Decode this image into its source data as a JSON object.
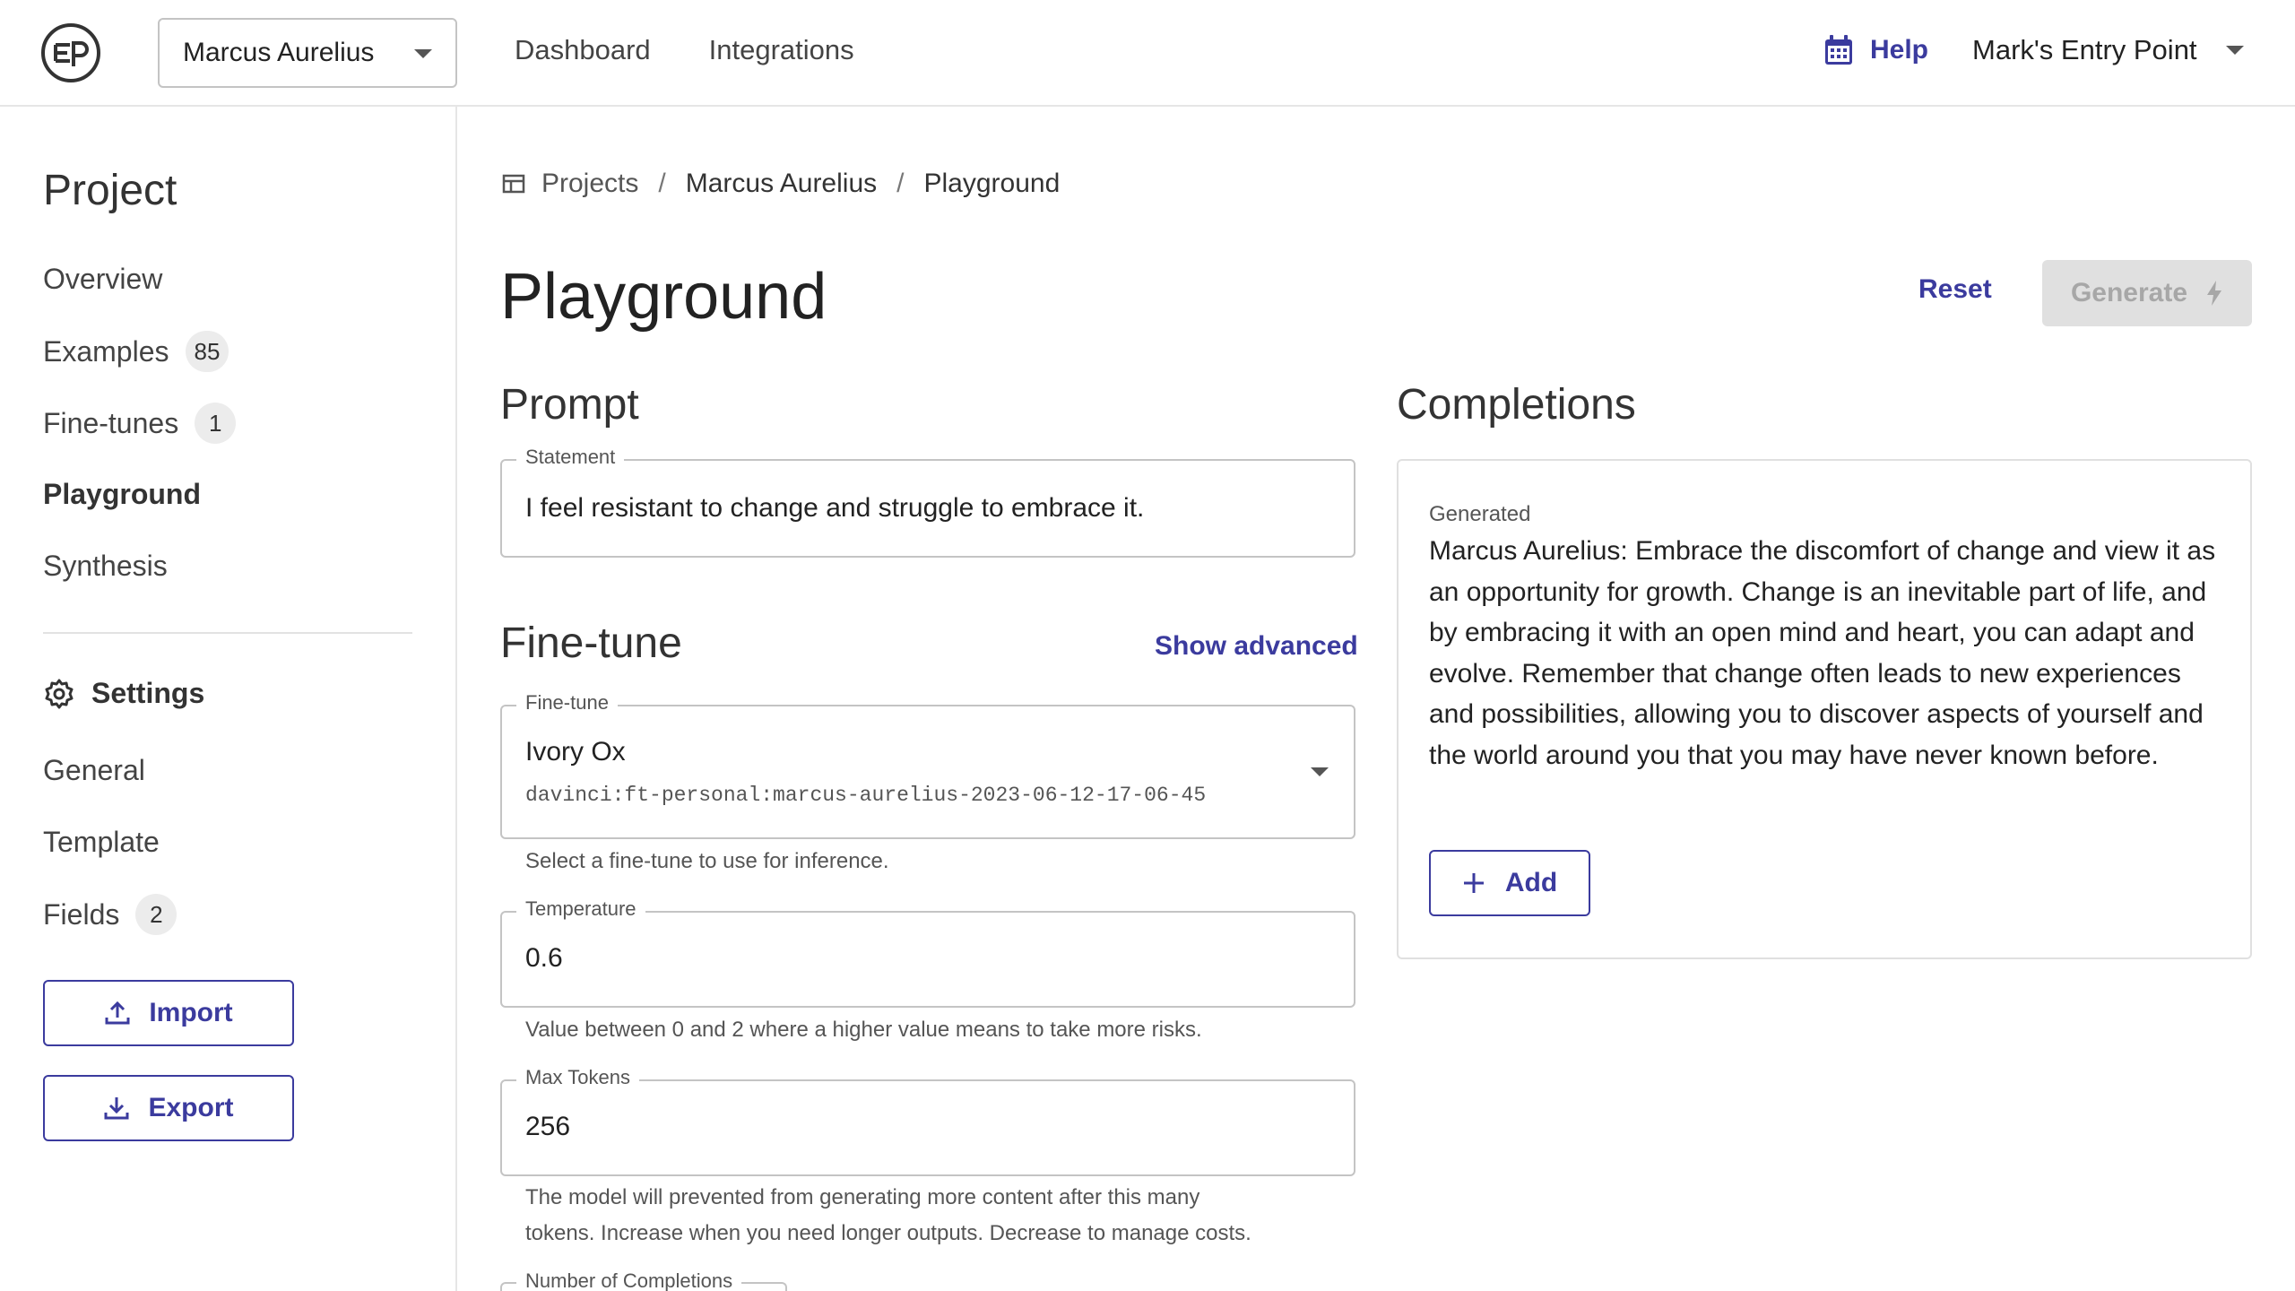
{
  "header": {
    "project_select": "Marcus Aurelius",
    "nav": [
      "Dashboard",
      "Integrations"
    ],
    "help": "Help",
    "account": "Mark's Entry Point"
  },
  "sidebar": {
    "title": "Project",
    "items": [
      {
        "label": "Overview"
      },
      {
        "label": "Examples",
        "badge": "85"
      },
      {
        "label": "Fine-tunes",
        "badge": "1"
      },
      {
        "label": "Playground",
        "active": true
      },
      {
        "label": "Synthesis"
      }
    ],
    "settings_title": "Settings",
    "settings_items": [
      {
        "label": "General"
      },
      {
        "label": "Template"
      },
      {
        "label": "Fields",
        "badge": "2"
      }
    ],
    "import_label": "Import",
    "export_label": "Export"
  },
  "breadcrumb": {
    "projects": "Projects",
    "project": "Marcus Aurelius",
    "current": "Playground",
    "separator": "/"
  },
  "page": {
    "title": "Playground",
    "reset_label": "Reset",
    "generate_label": "Generate"
  },
  "prompt": {
    "title": "Prompt",
    "statement_label": "Statement",
    "statement_value": "I feel resistant to change and struggle to embrace it."
  },
  "finetune": {
    "title": "Fine-tune",
    "show_advanced": "Show advanced",
    "select_label": "Fine-tune",
    "select_value": "Ivory Ox",
    "select_model_id": "davinci:ft-personal:marcus-aurelius-2023-06-12-17-06-45",
    "select_helper": "Select a fine-tune to use for inference.",
    "temperature_label": "Temperature",
    "temperature_value": "0.6",
    "temperature_helper": "Value between 0 and 2 where a higher value means to take more risks.",
    "max_tokens_label": "Max Tokens",
    "max_tokens_value": "256",
    "max_tokens_helper_line1": "The model will prevented from generating more content after this many",
    "max_tokens_helper_line2": "tokens. Increase when you need longer outputs. Decrease to manage costs.",
    "completions_label": "Number of Completions"
  },
  "completions": {
    "title": "Completions",
    "card_label": "Generated",
    "card_text": "Marcus Aurelius: Embrace the discomfort of change and view it as an opportunity for growth. Change is an inevitable part of life, and by embracing it with an open mind and heart, you can adapt and evolve. Remember that change often leads to new experiences and possibilities, allowing you to discover aspects of yourself and the world around you that you may have never known before.",
    "add_label": "Add"
  },
  "colors": {
    "accent": "#3b3b9e",
    "border": "#c4c4c4",
    "disabled_bg": "#e0e0e0"
  },
  "icons": [
    "logo-icon",
    "calendar-icon",
    "chevron-down-icon",
    "gear-icon",
    "upload-icon",
    "download-icon",
    "table-icon",
    "bolt-icon",
    "plus-icon"
  ]
}
